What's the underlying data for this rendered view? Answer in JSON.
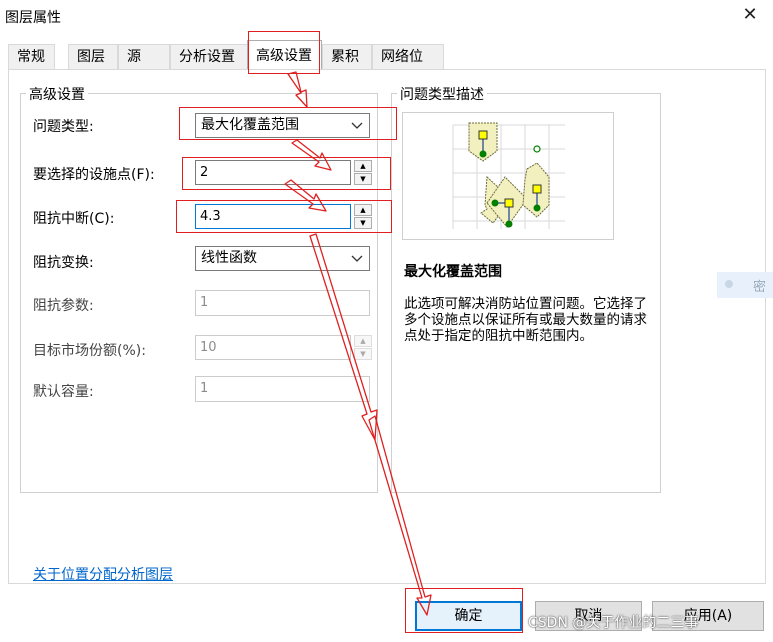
{
  "window": {
    "title": "图层属性",
    "close_symbol": "✕"
  },
  "tabs": [
    "常规",
    "图层",
    "源",
    "分析设置",
    "高级设置",
    "累积",
    "网络位置"
  ],
  "active_tab": "高级设置",
  "advanced": {
    "group_title": "高级设置",
    "problem_type_label": "问题类型:",
    "problem_type_value": "最大化覆盖范围",
    "facilities_label": "要选择的设施点(F):",
    "facilities_value": "2",
    "cutoff_label": "阻抗中断(C):",
    "cutoff_value": "4.3",
    "transform_label": "阻抗变换:",
    "transform_value": "线性函数",
    "param_label": "阻抗参数:",
    "param_value": "1",
    "share_label": "目标市场份额(%):",
    "share_value": "10",
    "capacity_label": "默认容量:",
    "capacity_value": "1"
  },
  "description": {
    "group_title": "问题类型描述",
    "heading": "最大化覆盖范围",
    "text": "此选项可解决消防站位置问题。它选择了多个设施点以保证所有或最大数量的请求点处于指定的阻抗中断范围内。"
  },
  "help_link": "关于位置分配分析图层",
  "buttons": {
    "ok": "确定",
    "cancel": "取消",
    "apply": "应用(A)"
  },
  "side_fragment": "密",
  "watermark": "CSDN @关于作业的二三事",
  "colors": {
    "annotation_red": "#e02020",
    "link": "#0066cc",
    "facility_yellow": "#ffff00",
    "demand_green": "#008000",
    "polygon_fill": "#f3f0c0"
  },
  "icons": {
    "dropdown": "chevron-down-icon",
    "spin_up": "▲",
    "spin_down": "▼",
    "dropdown_glyph": "∨"
  }
}
